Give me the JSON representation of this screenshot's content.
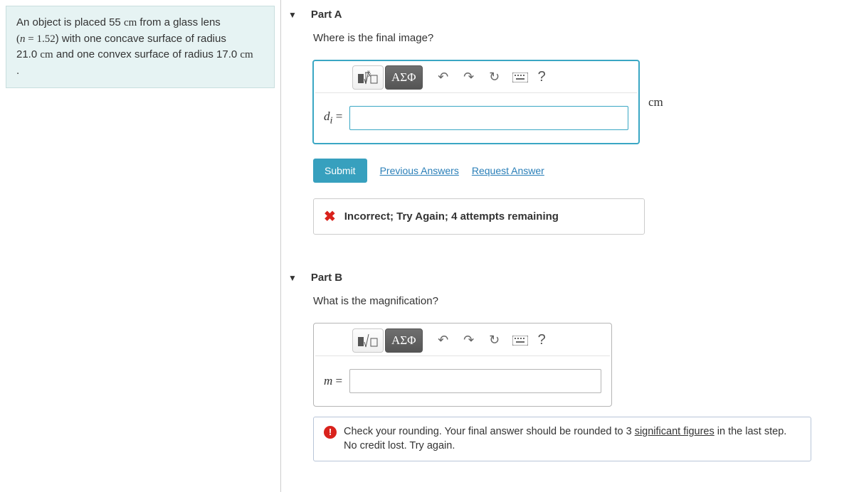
{
  "problem": {
    "line1a": "An object is placed 55 ",
    "line1b": " from a glass lens",
    "unit_cm": "cm",
    "line2a": "(",
    "n_eq": "n = 1.52",
    "line2b": ") with one concave surface of radius",
    "line3a": "21.0 ",
    "line3b": " and one convex surface of radius 17.0 ",
    "period": "."
  },
  "partA": {
    "title": "Part A",
    "question": "Where is the final image?",
    "prefix_var": "d",
    "prefix_sub": "i",
    "equals": " = ",
    "unit": "cm",
    "toolbar": {
      "asphi": "ΑΣΦ",
      "hint": "?"
    },
    "submit": "Submit",
    "prev": "Previous Answers",
    "request": "Request Answer",
    "feedback": "Incorrect; Try Again; 4 attempts remaining"
  },
  "partB": {
    "title": "Part B",
    "question": "What is the magnification?",
    "prefix_var": "m",
    "equals": " = ",
    "toolbar": {
      "asphi": "ΑΣΦ",
      "hint": "?"
    },
    "feedback_a": "Check your rounding. Your final answer should be rounded to 3 ",
    "feedback_link": "significant figures",
    "feedback_b": " in the last step. No credit lost. Try again."
  }
}
